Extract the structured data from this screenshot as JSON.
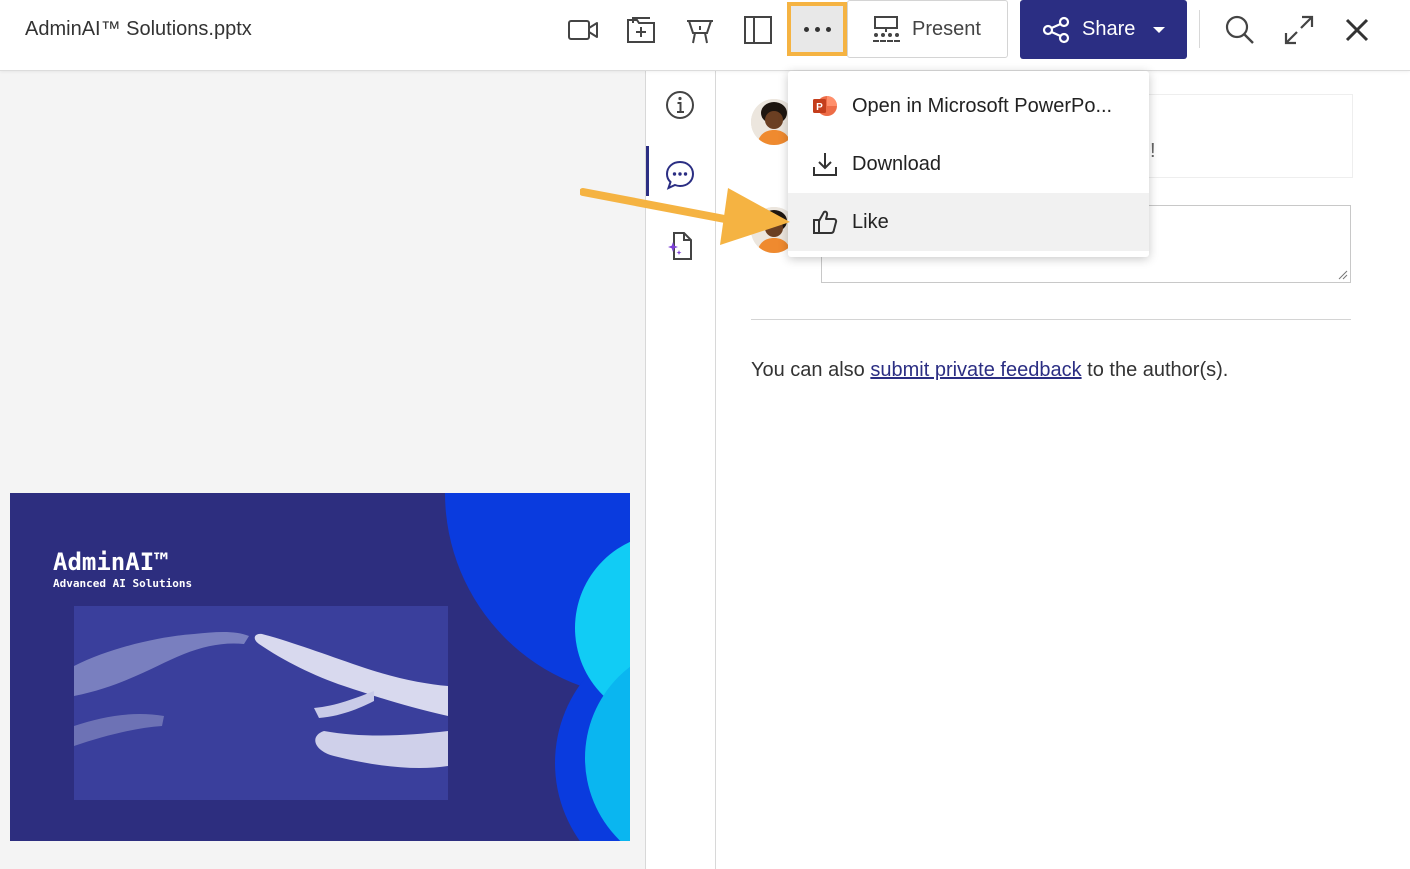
{
  "header": {
    "title": "AdminAI™ Solutions.pptx",
    "present_label": "Present",
    "share_label": "Share",
    "icons": [
      "video-camera-icon",
      "add-to-folder-icon",
      "presentation-stand-icon",
      "panel-toggle-icon",
      "more-options-icon",
      "search-icon",
      "expand-icon",
      "close-icon"
    ]
  },
  "menu": {
    "items": [
      {
        "label": "Open in Microsoft PowerPo...",
        "icon": "powerpoint-icon"
      },
      {
        "label": "Download",
        "icon": "download-icon"
      },
      {
        "label": "Like",
        "icon": "thumbs-up-icon"
      }
    ]
  },
  "comments": {
    "comment_tail": "!",
    "feedback_prefix": "You can also ",
    "feedback_link": "submit private feedback",
    "feedback_suffix": " to the author(s)."
  },
  "slide": {
    "title": "AdminAI™",
    "subtitle": "Advanced AI Solutions"
  },
  "colors": {
    "accent": "#2b2e83",
    "highlight": "#f5b342",
    "slide_bg": "#2d2e7f"
  }
}
